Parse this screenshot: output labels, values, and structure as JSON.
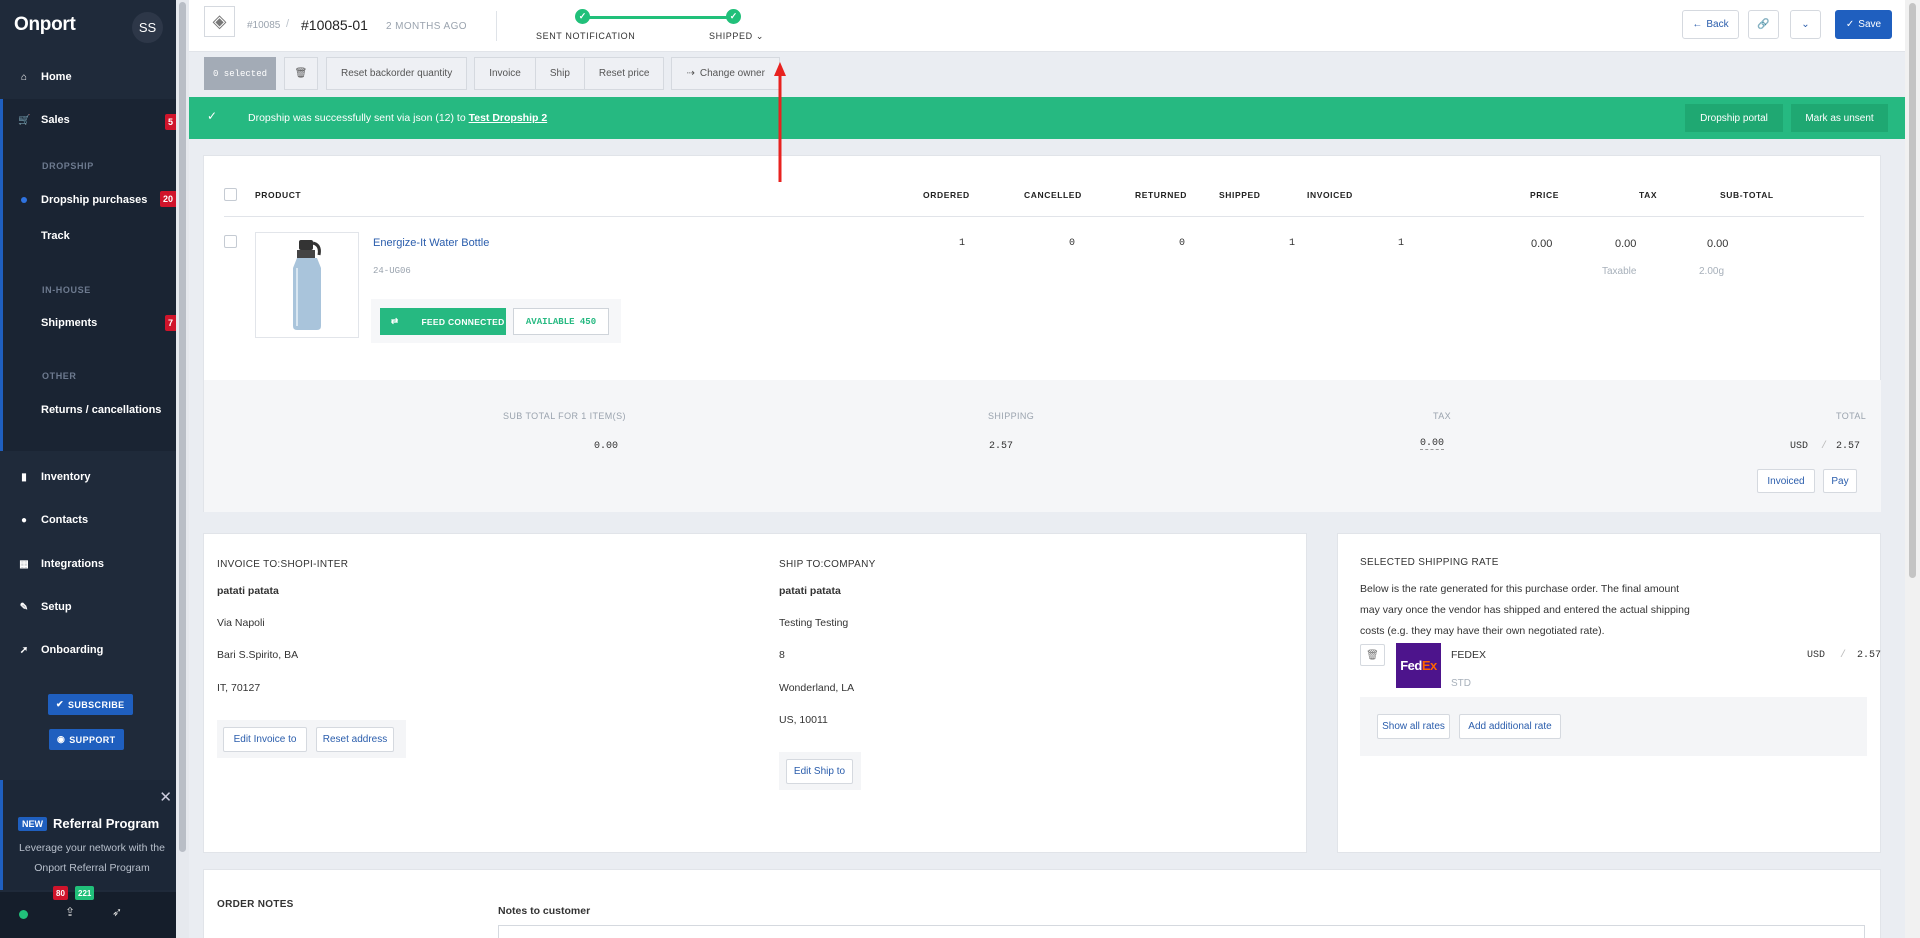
{
  "sidebar": {
    "brand": "Onport",
    "avatar": "SS",
    "nav": [
      {
        "label": "Home",
        "icon": "home-icon"
      },
      {
        "label": "Sales",
        "icon": "cart-icon",
        "badge": "5"
      },
      {
        "label": "Inventory",
        "icon": "bookmark-icon"
      },
      {
        "label": "Contacts",
        "icon": "user-icon"
      },
      {
        "label": "Integrations",
        "icon": "grid-icon"
      },
      {
        "label": "Setup",
        "icon": "wrench-icon"
      },
      {
        "label": "Onboarding",
        "icon": "rocket-icon"
      }
    ],
    "sections": {
      "dropship": "DROPSHIP",
      "inhouse": "IN-HOUSE",
      "other": "OTHER"
    },
    "sub": {
      "dropship_purchases": "Dropship purchases",
      "dropship_badge": "20",
      "track": "Track",
      "shipments": "Shipments",
      "shipments_badge": "7",
      "returns": "Returns / cancellations"
    },
    "subscribe": "SUBSCRIBE",
    "support": "SUPPORT",
    "referral": {
      "new": "NEW",
      "title": "Referral Program",
      "desc": "Leverage your network with the Onport Referral Program"
    },
    "bottom_badges": [
      "80",
      "221"
    ]
  },
  "header": {
    "order_small": "#10085",
    "order_main": "#10085-01",
    "time": "2 MONTHS AGO",
    "step1": "SENT NOTIFICATION",
    "step2": "SHIPPED",
    "back": "Back",
    "save": "Save"
  },
  "actions": {
    "selected": "0 selected",
    "reset_backorder": "Reset backorder quantity",
    "invoice": "Invoice",
    "ship": "Ship",
    "reset_price": "Reset price",
    "change_owner": "Change owner"
  },
  "notice": {
    "message": "Dropship was successfully sent via json (12) to",
    "link": "Test Dropship 2",
    "portal_btn": "Dropship portal",
    "unsent_btn": "Mark as unsent"
  },
  "table": {
    "headers": [
      "PRODUCT",
      "ORDERED",
      "CANCELLED",
      "RETURNED",
      "SHIPPED",
      "INVOICED",
      "PRICE",
      "TAX",
      "SUB-TOTAL"
    ],
    "row": {
      "name": "Energize-It Water Bottle",
      "sku": "24-UG06",
      "ordered": "1",
      "cancelled": "0",
      "returned": "0",
      "shipped": "1",
      "invoiced": "1",
      "price": "0.00",
      "tax": "0.00",
      "subtotal": "0.00",
      "taxable": "Taxable",
      "weight": "2.00g",
      "feed": "FEED CONNECTED",
      "available": "AVAILABLE 450"
    }
  },
  "totals": {
    "subtotal_label": "SUB TOTAL FOR 1 ITEM(S)",
    "subtotal": "0.00",
    "shipping_label": "SHIPPING",
    "shipping": "2.57",
    "tax_label": "TAX",
    "tax": "0.00",
    "total_label": "TOTAL",
    "currency": "USD",
    "total": "2.57",
    "invoiced_btn": "Invoiced",
    "pay_btn": "Pay"
  },
  "invoice_to": {
    "title": "INVOICE TO:SHOPI-INTER",
    "name": "patati patata",
    "line1": "Via Napoli",
    "line2": "Bari S.Spirito, BA",
    "line3": "IT, 70127",
    "edit_btn": "Edit Invoice to",
    "reset_btn": "Reset address"
  },
  "ship_to": {
    "title": "SHIP TO:COMPANY",
    "name": "patati patata",
    "line1": "Testing Testing",
    "line2": "8",
    "line3": "Wonderland, LA",
    "line4": "US, 10011",
    "edit_btn": "Edit Ship to"
  },
  "shipping_rate": {
    "title": "SELECTED SHIPPING RATE",
    "desc": "Below is the rate generated for this purchase order. The final amount may vary once the vendor has shipped and entered the actual shipping costs (e.g. they may have their own negotiated rate).",
    "carrier": "FEDEX",
    "service": "STD",
    "currency": "USD",
    "amount": "2.57",
    "show_all": "Show all rates",
    "add_rate": "Add additional rate"
  },
  "notes": {
    "title": "ORDER NOTES",
    "customer_label": "Notes to customer"
  },
  "colors": {
    "accent": "#1f5fbf",
    "success": "#26b981",
    "sidebar": "#1f2a3a",
    "danger": "#d0142b"
  }
}
